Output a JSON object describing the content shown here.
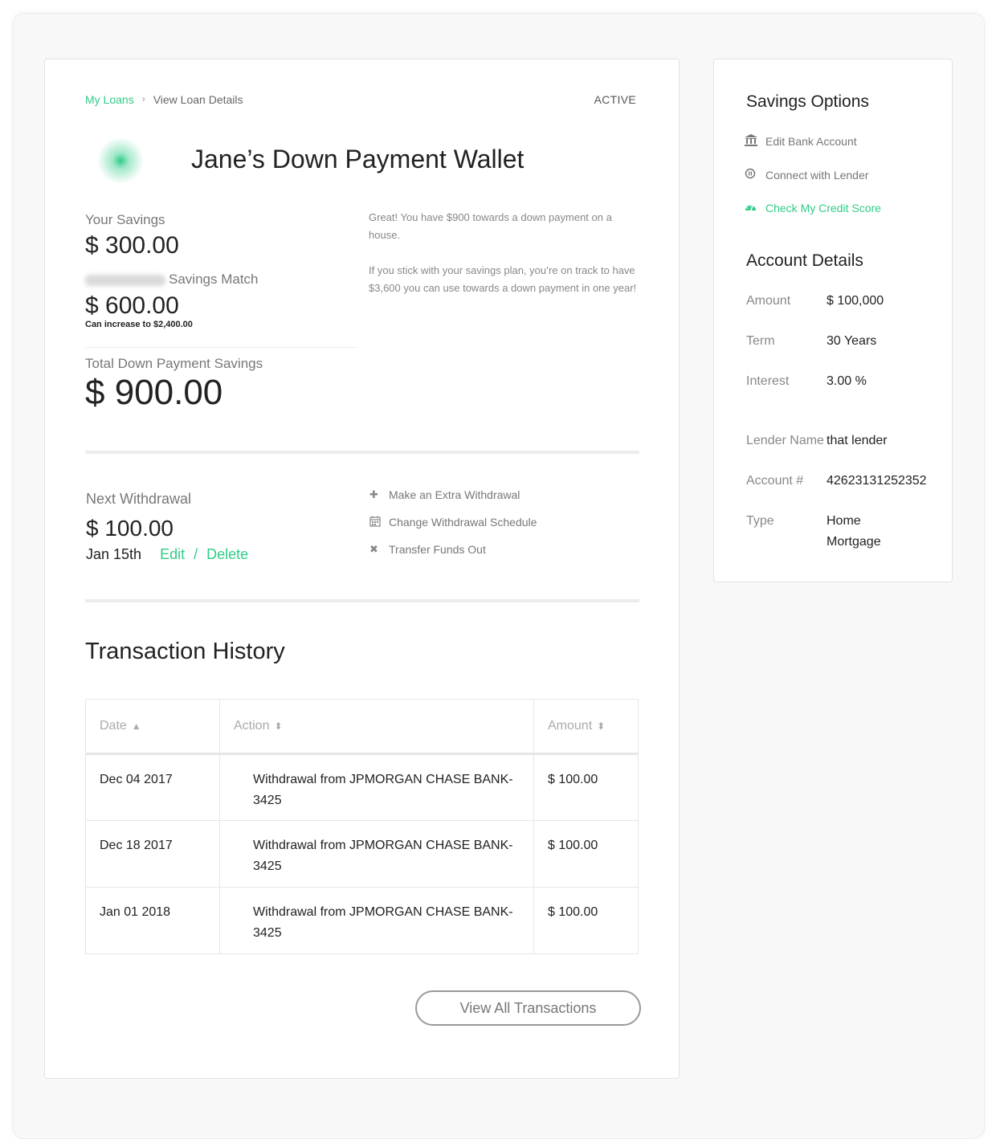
{
  "breadcrumb": {
    "parent": "My Loans",
    "separator": "›",
    "current": "View Loan Details"
  },
  "status": "ACTIVE",
  "wallet_title": "Jane’s Down Payment Wallet",
  "savings": {
    "your_label": "Your Savings",
    "your_amount": "$ 300.00",
    "match_label": "Savings Match",
    "match_amount": "$ 600.00",
    "match_note": "Can increase to $2,400.00",
    "total_label": "Total Down Payment Savings",
    "total_amount": "$ 900.00"
  },
  "message": {
    "p1": "Great! You have $900 towards a down payment on a house.",
    "p2": "If you stick with your savings plan, you’re on track to have $3,600 you can use towards a down payment in one year!"
  },
  "withdrawal": {
    "label": "Next Withdrawal",
    "amount": "$ 100.00",
    "date": "Jan 15th",
    "edit": "Edit",
    "slash": "/",
    "delete": "Delete"
  },
  "actions": [
    {
      "icon": "plus-icon",
      "label": "Make an Extra Withdrawal"
    },
    {
      "icon": "calendar-icon",
      "label": "Change Withdrawal Schedule"
    },
    {
      "icon": "x-icon",
      "label": "Transfer Funds Out"
    }
  ],
  "transactions": {
    "title": "Transaction History",
    "columns": [
      "Date",
      "Action",
      "Amount"
    ],
    "rows": [
      {
        "date": "Dec 04 2017",
        "action": "Withdrawal from JPMORGAN CHASE BANK-3425",
        "amount": "$ 100.00"
      },
      {
        "date": "Dec 18 2017",
        "action": "Withdrawal from JPMORGAN CHASE BANK-3425",
        "amount": "$ 100.00"
      },
      {
        "date": "Jan 01 2018",
        "action": "Withdrawal from JPMORGAN CHASE BANK-3425",
        "amount": "$ 100.00"
      }
    ],
    "view_all": "View All Transactions"
  },
  "savings_options": {
    "title": "Savings Options",
    "items": [
      {
        "icon": "bank-icon",
        "label": "Edit Bank Account"
      },
      {
        "icon": "link-icon",
        "label": "Connect with Lender"
      },
      {
        "icon": "gauge-icon",
        "label": "Check My Credit Score"
      }
    ]
  },
  "account_details": {
    "title": "Account Details",
    "rows": [
      {
        "key": "Amount",
        "value": "$ 100,000"
      },
      {
        "key": "Term",
        "value": "30 Years"
      },
      {
        "key": "Interest",
        "value": "3.00 %"
      },
      {
        "key": "Lender Name",
        "value": "that lender"
      },
      {
        "key": "Account #",
        "value": "42623131252352"
      },
      {
        "key": "Type",
        "value": "Home Mortgage"
      }
    ]
  },
  "colors": {
    "accent": "#2ecc87",
    "text": "#222222",
    "muted": "#777777",
    "border": "#e3e3e3"
  }
}
